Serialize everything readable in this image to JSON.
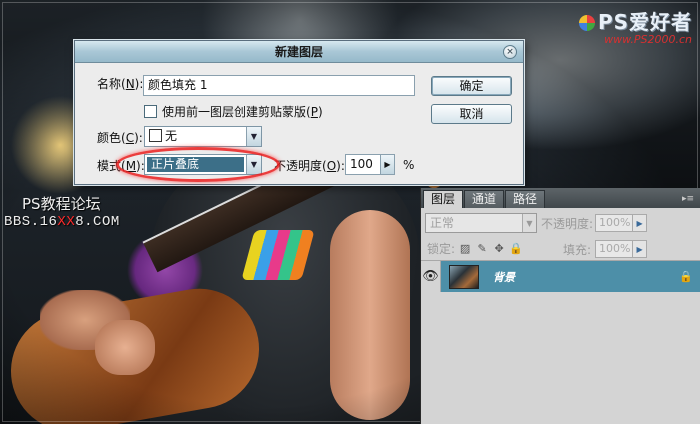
{
  "watermark": {
    "site_name": "PS爱好者",
    "site_url": "www.PS2000.cn",
    "forum_name": "PS教程论坛",
    "forum_url_prefix": "BBS.16",
    "forum_url_highlight": "XX",
    "forum_url_suffix": "8.COM"
  },
  "dialog": {
    "title": "新建图层",
    "close_glyph": "×",
    "name_label": "名称(",
    "name_mnemonic": "N",
    "name_label_end": "):",
    "name_value": "颜色填充 1",
    "clip_checkbox_label": "使用前一图层创建剪贴蒙版(",
    "clip_mnemonic": "P",
    "clip_label_end": ")",
    "clip_checked": false,
    "color_label": "颜色(",
    "color_mnemonic": "C",
    "color_label_end": "):",
    "color_value": "无",
    "mode_label": "模式(",
    "mode_mnemonic": "M",
    "mode_label_end": "):",
    "mode_value": "正片叠底",
    "opacity_label": "不透明度(",
    "opacity_mnemonic": "O",
    "opacity_label_end": "):",
    "opacity_value": "100",
    "opacity_unit": "%",
    "ok_label": "确定",
    "cancel_label": "取消",
    "highlight_color": "#e81e1e"
  },
  "layers_panel": {
    "tabs": [
      {
        "label": "图层",
        "active": true
      },
      {
        "label": "通道",
        "active": false
      },
      {
        "label": "路径",
        "active": false
      }
    ],
    "blend_mode": "正常",
    "opacity_label": "不透明度:",
    "opacity_value": "100%",
    "lock_label": "锁定:",
    "fill_label": "填充:",
    "fill_value": "100%",
    "layers": [
      {
        "name": "背景",
        "visible": true,
        "locked": true
      }
    ],
    "selected_color": "#4d8fa8"
  }
}
